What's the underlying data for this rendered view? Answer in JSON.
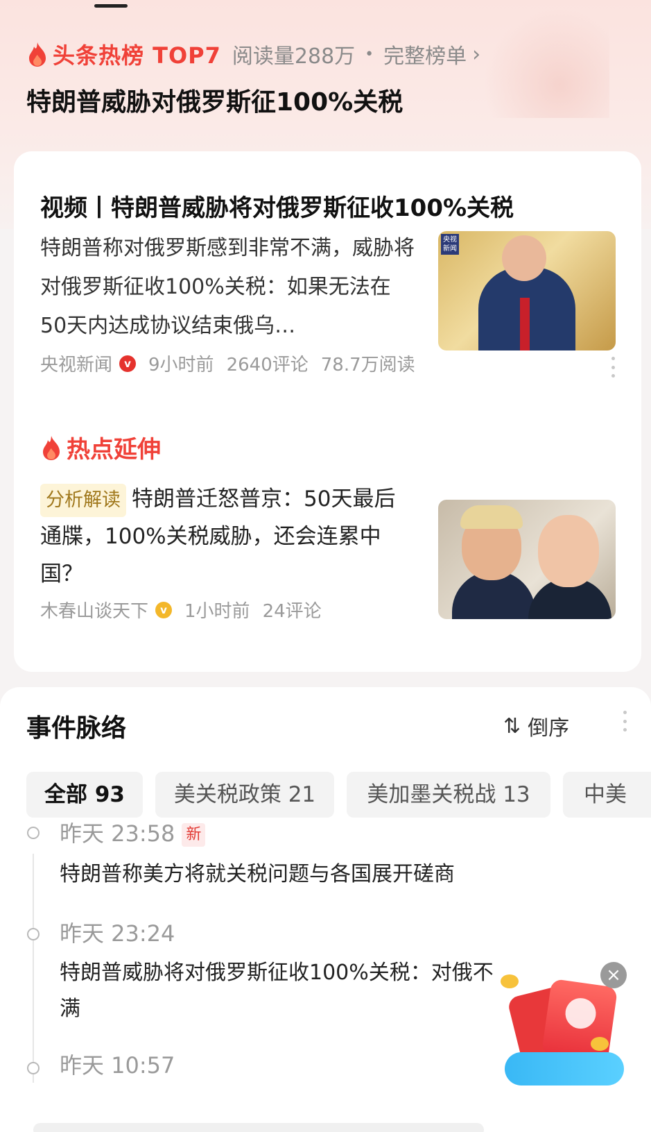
{
  "header": {
    "hot_label": "头条热榜 TOP7",
    "read_count": "阅读量288万",
    "separator": "•",
    "full_list": "完整榜单",
    "chevron": "›",
    "headline": "特朗普威胁对俄罗斯征100%关税"
  },
  "article": {
    "title": "视频丨特朗普威胁将对俄罗斯征收100%关税",
    "summary": "特朗普称对俄罗斯感到非常不满，威胁将对俄罗斯征收100%关税：如果无法在50天内达成协议结束俄乌…",
    "thumb_logo": "央视新闻",
    "source": "央视新闻",
    "verified": "v",
    "time": "9小时前",
    "comments": "2640评论",
    "reads": "78.7万阅读"
  },
  "extension": {
    "title": "热点延伸",
    "tag": "分析解读",
    "text": "特朗普迁怒普京：50天最后通牒，100%关税威胁，还会连累中国？",
    "source": "木春山谈天下",
    "verified": "v",
    "time": "1小时前",
    "comments": "24评论"
  },
  "timeline": {
    "title": "事件脉络",
    "sort_icon": "⇅",
    "sort_label": "倒序",
    "chips": [
      {
        "label": "全部 93",
        "active": true
      },
      {
        "label": "美关税政策 21",
        "active": false
      },
      {
        "label": "美加墨关税战 13",
        "active": false
      },
      {
        "label": "中美",
        "active": false
      }
    ],
    "events": [
      {
        "time": "昨天 23:58",
        "badge": "新",
        "text": "特朗普称美方将就关税问题与各国展开磋商"
      },
      {
        "time": "昨天 23:24",
        "badge": "",
        "text": "特朗普威胁将对俄罗斯征收100%关税：对俄不满"
      },
      {
        "time": "昨天 10:57",
        "badge": "",
        "text": ""
      }
    ]
  },
  "floating": {
    "close_label": "×"
  },
  "colors": {
    "accent": "#f04138",
    "muted": "#9a9a9a",
    "tag_bg": "#fdf4d8"
  }
}
